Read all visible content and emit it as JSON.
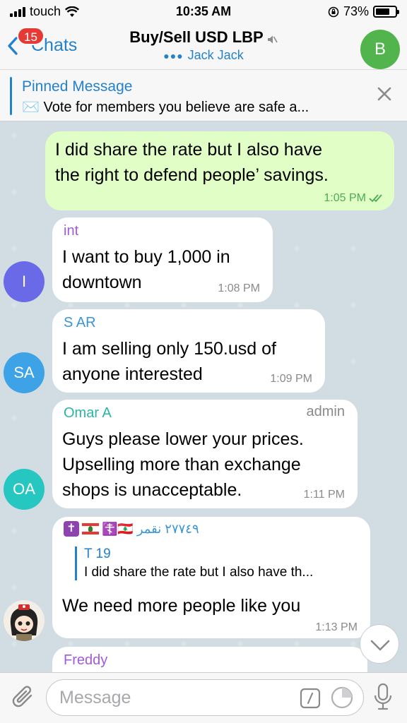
{
  "status_bar": {
    "carrier": "touch",
    "time": "10:35 AM",
    "battery": "73%",
    "battery_level": 0.73
  },
  "header": {
    "back_label": "Chats",
    "unread_badge": "15",
    "title": "Buy/Sell USD LBP",
    "subtitle": "Jack Jack",
    "avatar_initial": "B",
    "avatar_color": "#51b44c"
  },
  "pinned": {
    "label": "Pinned Message",
    "text": "✉️ Vote for members you believe are safe a..."
  },
  "messages": [
    {
      "type": "outgoing",
      "lines": [
        "I did share the rate but I also have",
        "the right to defend people’ savings."
      ],
      "time": "1:05 PM"
    },
    {
      "type": "incoming",
      "sender": "int",
      "sender_color": "#a05bd9",
      "avatar_initial": "I",
      "avatar_color": "#6a6ae8",
      "lines": [
        "I want to buy 1,000 in",
        "downtown"
      ],
      "time": "1:08 PM"
    },
    {
      "type": "incoming",
      "sender": "S AR",
      "sender_color": "#3a95d6",
      "avatar_initial": "SA",
      "avatar_color": "#3ea2e6",
      "lines": [
        "I am selling only 150.usd of",
        "anyone interested"
      ],
      "time": "1:09 PM"
    },
    {
      "type": "incoming",
      "sender": "Omar A",
      "sender_color": "#2bb5a5",
      "role": "admin",
      "avatar_initial": "OA",
      "avatar_color": "#27c7c1",
      "lines": [
        "Guys please lower your prices.",
        "Upselling more than exchange",
        "shops is unacceptable."
      ],
      "time": "1:11 PM"
    },
    {
      "type": "incoming",
      "sender": "☦️🇱🇧 ٢٧٧٤٩ نقمر",
      "sender_color": "#3a95d6",
      "reply_name": "T 19",
      "reply_text": "I did share the rate but I also have th...",
      "lines": [
        "We need more people like you"
      ],
      "time": "1:13 PM"
    },
    {
      "type": "incoming",
      "sender": "Freddy",
      "sender_color": "#a05bd9"
    }
  ],
  "input": {
    "placeholder": "Message"
  }
}
